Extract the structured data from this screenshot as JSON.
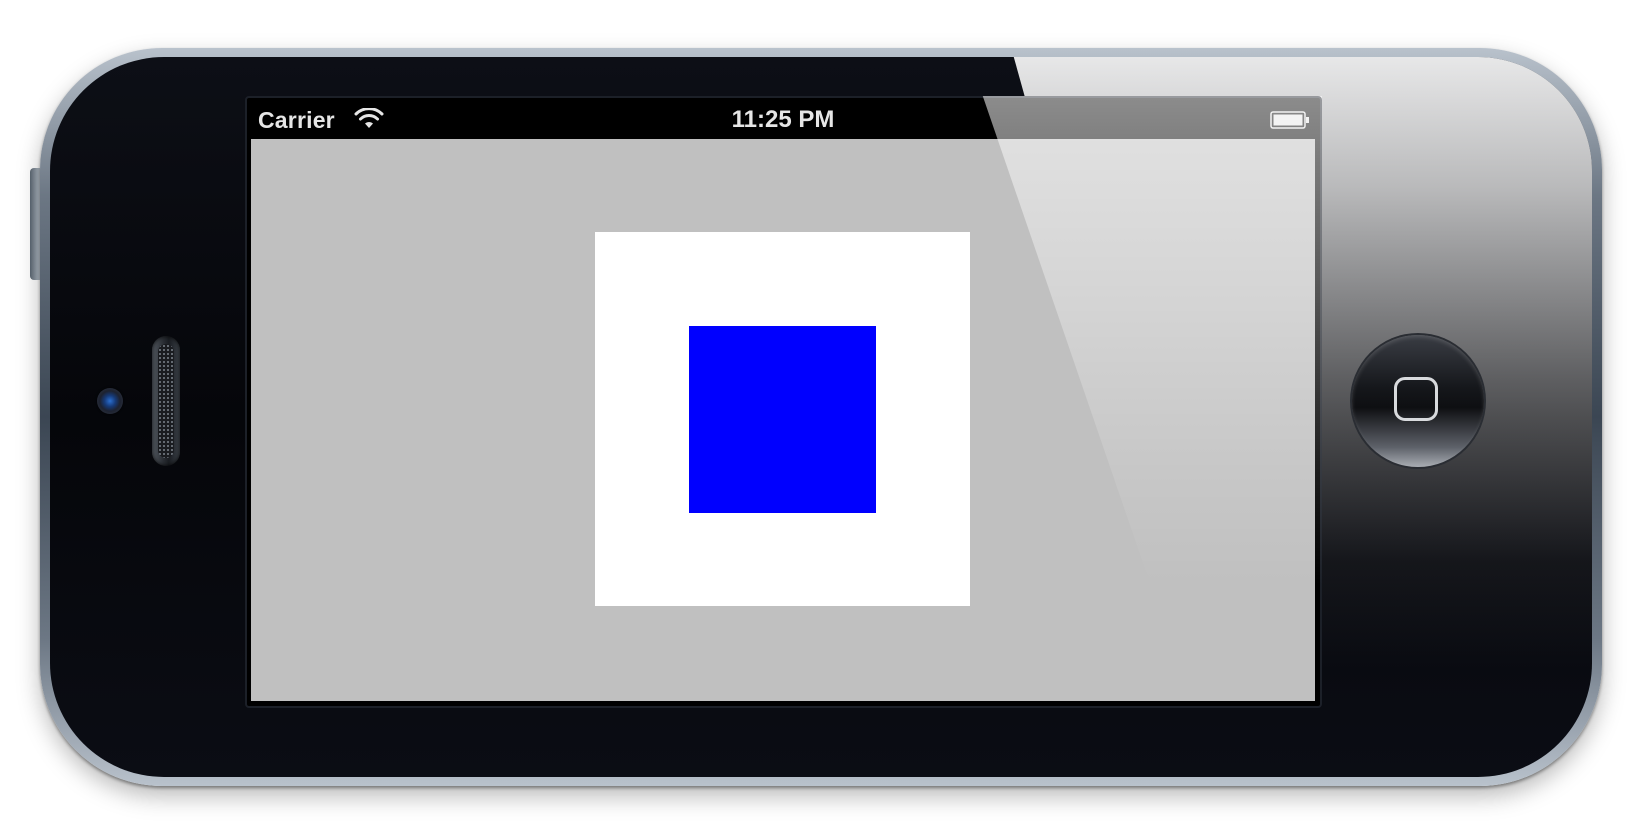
{
  "device": {
    "model": "iPhone"
  },
  "status_bar": {
    "carrier": "Carrier",
    "time": "11:25 PM",
    "wifi_icon": "wifi-icon",
    "battery_icon": "battery-icon"
  },
  "screen": {
    "background_color": "#c0c0c0",
    "outer_view_color": "#ffffff",
    "inner_view_color": "#0000ff"
  },
  "hardware": {
    "home_button_icon": "home-square-icon",
    "camera_icon": "camera-icon",
    "speaker_icon": "speaker-icon"
  }
}
